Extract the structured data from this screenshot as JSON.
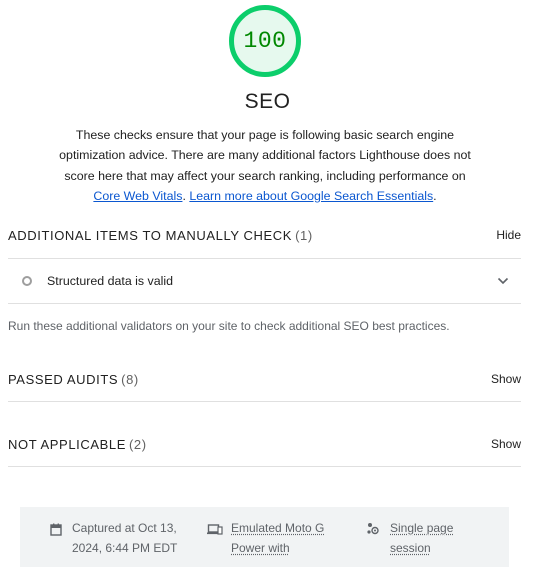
{
  "colors": {
    "pass_accent": "#0cce6b",
    "pass_text": "#008800",
    "link": "#0b57d0"
  },
  "score": {
    "value": "100",
    "category": "SEO"
  },
  "description": {
    "text": "These checks ensure that your page is following basic search engine optimization advice. There are many additional factors Lighthouse does not score here that may affect your search ranking, including performance on",
    "link1": "Core Web Vitals",
    "separator": ". ",
    "link2": "Learn more about Google Search Essentials",
    "end": "."
  },
  "groups": {
    "manual": {
      "title": "ADDITIONAL ITEMS TO MANUALLY CHECK",
      "count": "(1)",
      "toggle": "Hide",
      "audits": [
        {
          "title": "Structured data is valid",
          "icon": "neutral-circle-icon"
        }
      ],
      "description": "Run these additional validators on your site to check additional SEO best practices."
    },
    "passed": {
      "title": "PASSED AUDITS",
      "count": "(8)",
      "toggle": "Show"
    },
    "not_applicable": {
      "title": "NOT APPLICABLE",
      "count": "(2)",
      "toggle": "Show"
    }
  },
  "footer": {
    "captured": {
      "line1": "Captured at Oct 13,",
      "line2": "2024, 6:44 PM EDT",
      "icon": "calendar-icon"
    },
    "emulated": {
      "line1": "Emulated Moto G",
      "line2": "Power with",
      "icon": "devices-icon"
    },
    "session": {
      "line1": "Single page",
      "line2": "session",
      "icon": "session-icon"
    }
  }
}
